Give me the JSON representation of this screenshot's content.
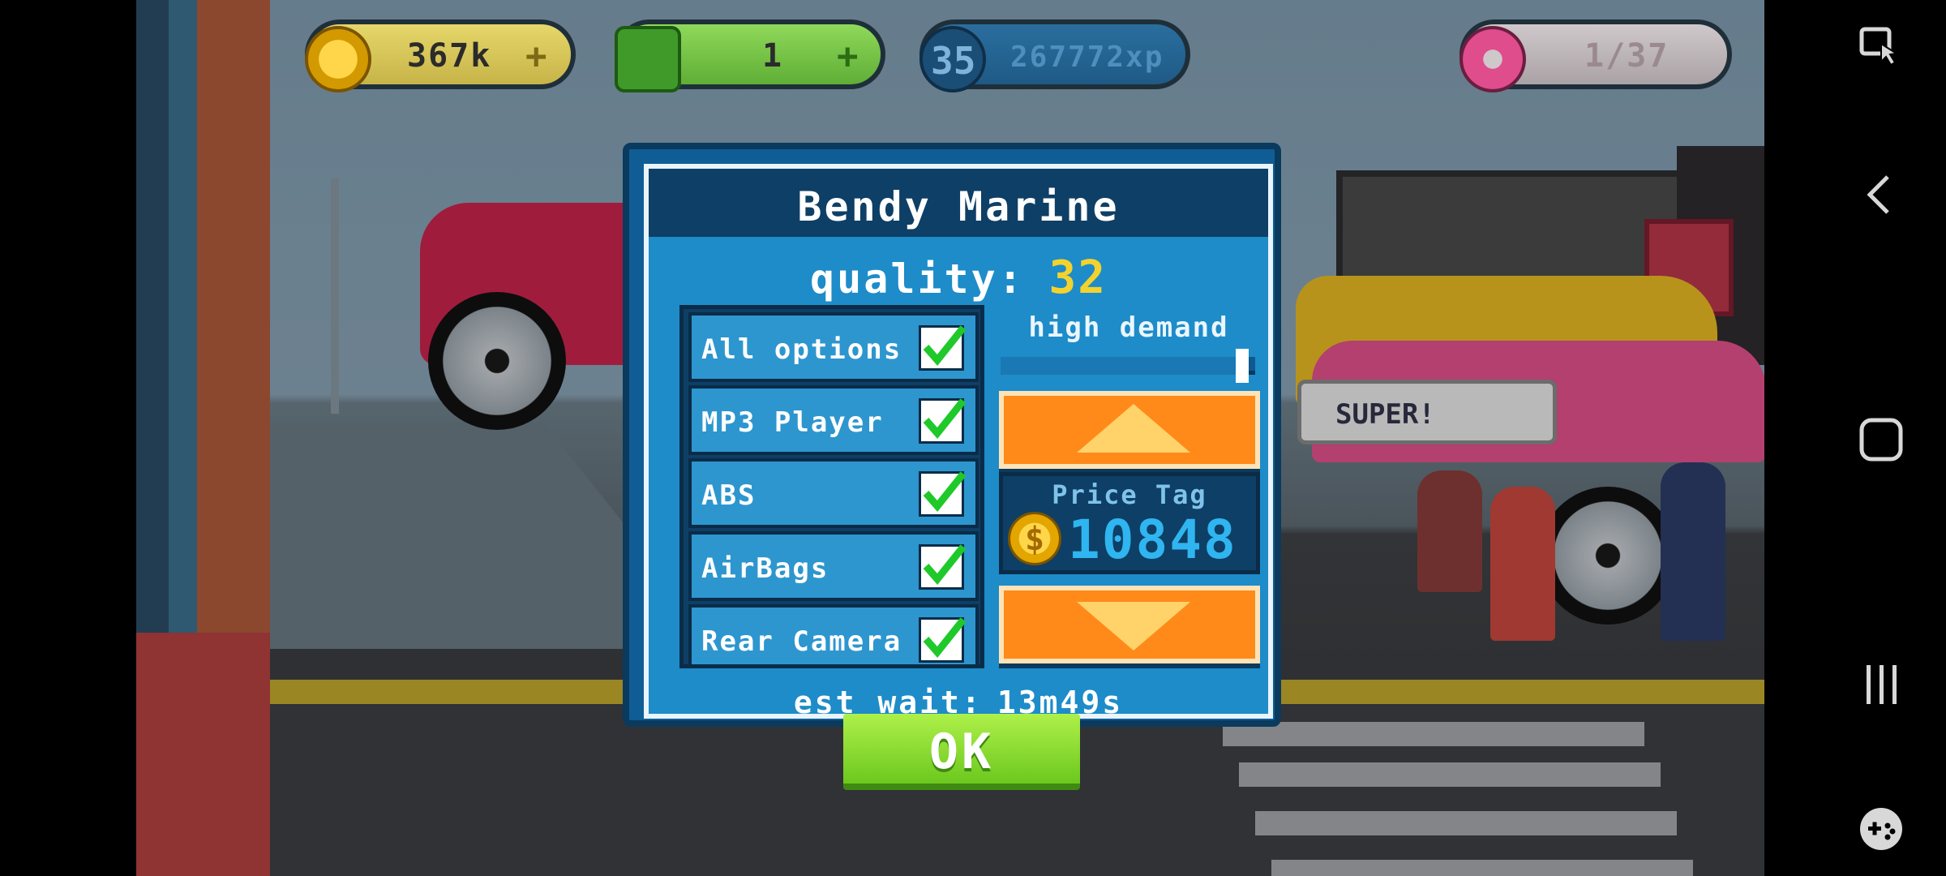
{
  "hud": {
    "coins": "367k",
    "cash": "1",
    "level": "35",
    "xp": "267772xp",
    "donuts": "1/37",
    "plus_symbol": "+"
  },
  "scene": {
    "speech_bubble": "SUPER!"
  },
  "dialog": {
    "title": "Bendy Marine",
    "quality_label": "quality:",
    "quality_value": "32",
    "options": [
      {
        "label": "All options",
        "checked": true
      },
      {
        "label": "MP3 Player",
        "checked": true
      },
      {
        "label": "ABS",
        "checked": true
      },
      {
        "label": "AirBags",
        "checked": true
      },
      {
        "label": "Rear Camera",
        "checked": true
      }
    ],
    "demand_label": "high demand",
    "demand_level": 0.95,
    "price_label": "Price Tag",
    "price_value": "10848",
    "coin_symbol": "$",
    "wait_label": "est wait:",
    "wait_value": "13m49s",
    "ok_label": "OK"
  },
  "colors": {
    "panel_blue": "#1d8cc9",
    "title_bar": "#0e3f66",
    "quality_yellow": "#f4d22e",
    "price_blue": "#2fb5f0",
    "arrow_orange": "#ff8a1a",
    "ok_green": "#7ed321",
    "check_green": "#1fc92a"
  },
  "navbar": {
    "icons": [
      "screen-pin-icon",
      "back-icon",
      "home-icon",
      "recents-icon",
      "game-tools-icon"
    ]
  }
}
